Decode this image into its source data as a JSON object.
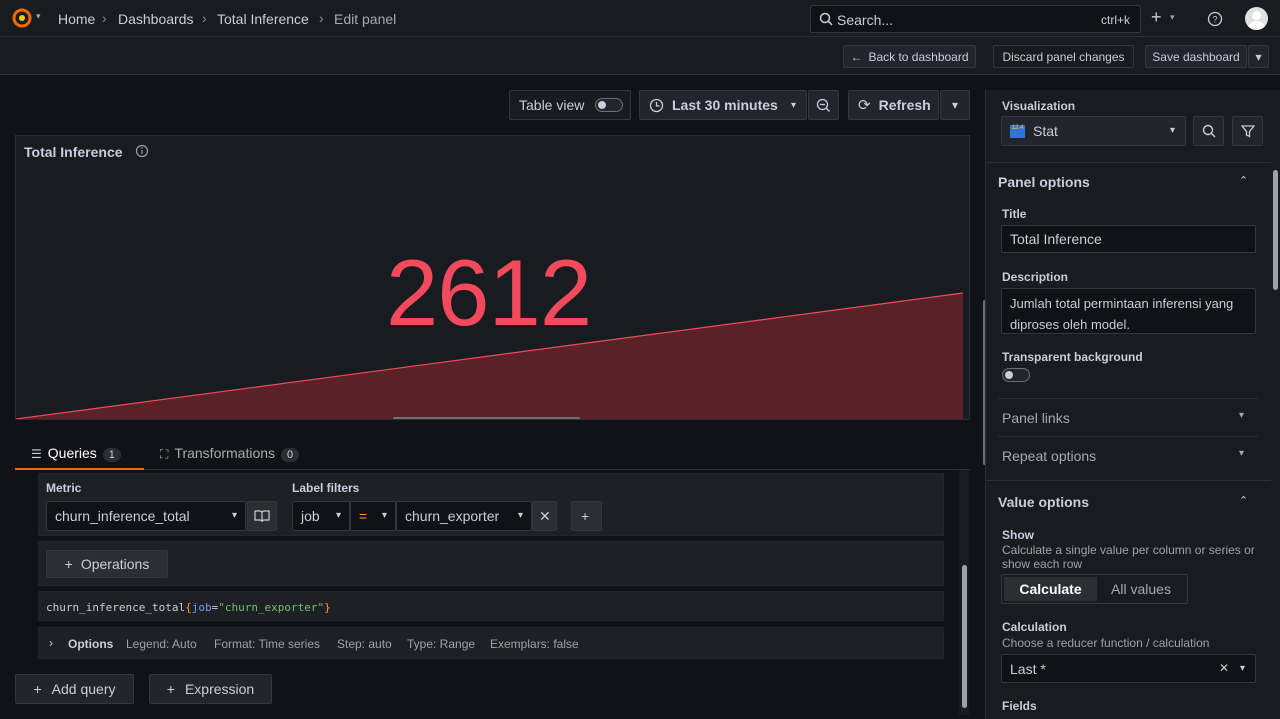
{
  "breadcrumbs": [
    "Home",
    "Dashboards",
    "Total Inference",
    "Edit panel"
  ],
  "search": {
    "placeholder": "Search...",
    "shortcut": "ctrl+k"
  },
  "actions": {
    "back": "Back to dashboard",
    "discard": "Discard panel changes",
    "save": "Save dashboard"
  },
  "toolbar": {
    "table_view": "Table view",
    "time_range": "Last 30 minutes",
    "refresh": "Refresh"
  },
  "panel": {
    "title": "Total Inference",
    "value": "2612",
    "accent": "#f2495c"
  },
  "tabs": [
    {
      "label": "Queries",
      "count": "1"
    },
    {
      "label": "Transformations",
      "count": "0"
    }
  ],
  "query": {
    "metric_label": "Metric",
    "metric": "churn_inference_total",
    "label_filters_label": "Label filters",
    "filter_key": "job",
    "filter_op": "=",
    "filter_value": "churn_exporter",
    "operations": "Operations",
    "expr_metric": "churn_inference_total",
    "expr_open": "{",
    "expr_key": "job",
    "expr_eq": "=",
    "expr_val": "\"churn_exporter\"",
    "expr_close": "}",
    "options_label": "Options",
    "options_legend": "Legend: Auto",
    "options_format": "Format: Time series",
    "options_step": "Step: auto",
    "options_type": "Type: Range",
    "options_exemplars": "Exemplars: false"
  },
  "bottom_actions": {
    "add_query": "Add query",
    "expression": "Expression"
  },
  "sidebar": {
    "visualization_label": "Visualization",
    "visualization": "Stat",
    "viz_icon_text": "12.4",
    "panel_options": "Panel options",
    "title_label": "Title",
    "title_value": "Total Inference",
    "description_label": "Description",
    "description_value": "Jumlah total permintaan inferensi yang diproses oleh model.",
    "transparent_label": "Transparent background",
    "panel_links": "Panel links",
    "repeat_options": "Repeat options",
    "value_options": "Value options",
    "show_label": "Show",
    "show_desc": "Calculate a single value per column or series or show each row",
    "calculate": "Calculate",
    "all_values": "All values",
    "calculation_label": "Calculation",
    "calculation_desc": "Choose a reducer function / calculation",
    "calculation_value": "Last *",
    "fields_label": "Fields"
  }
}
